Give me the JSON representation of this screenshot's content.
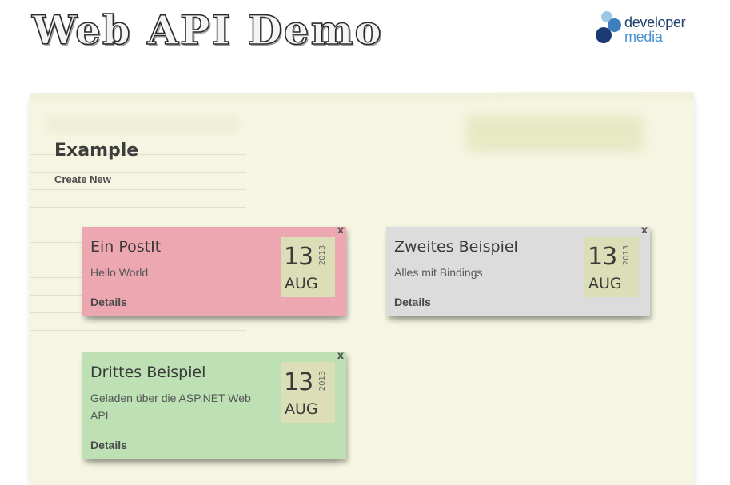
{
  "header": {
    "title": "Web API Demo",
    "brand": {
      "line1": "developer",
      "line2": "media"
    }
  },
  "page": {
    "heading": "Example",
    "create_new": "Create New"
  },
  "notes": [
    {
      "title": "Ein PostIt",
      "text": "Hello World",
      "day": "13",
      "month": "AUG",
      "year": "2013",
      "details": "Details",
      "close": "x",
      "color": "#eda7b1"
    },
    {
      "title": "Zweites Beispiel",
      "text": "Alles mit Bindings",
      "day": "13",
      "month": "AUG",
      "year": "2013",
      "details": "Details",
      "close": "x",
      "color": "#dcdcdc"
    },
    {
      "title": "Drittes Beispiel",
      "text": "Geladen über die ASP.NET Web API",
      "day": "13",
      "month": "AUG",
      "year": "2013",
      "details": "Details",
      "close": "x",
      "color": "#bde0b4"
    }
  ],
  "colors": {
    "paper": "#f5f5e1",
    "date_tag": "#dcdeb7"
  }
}
